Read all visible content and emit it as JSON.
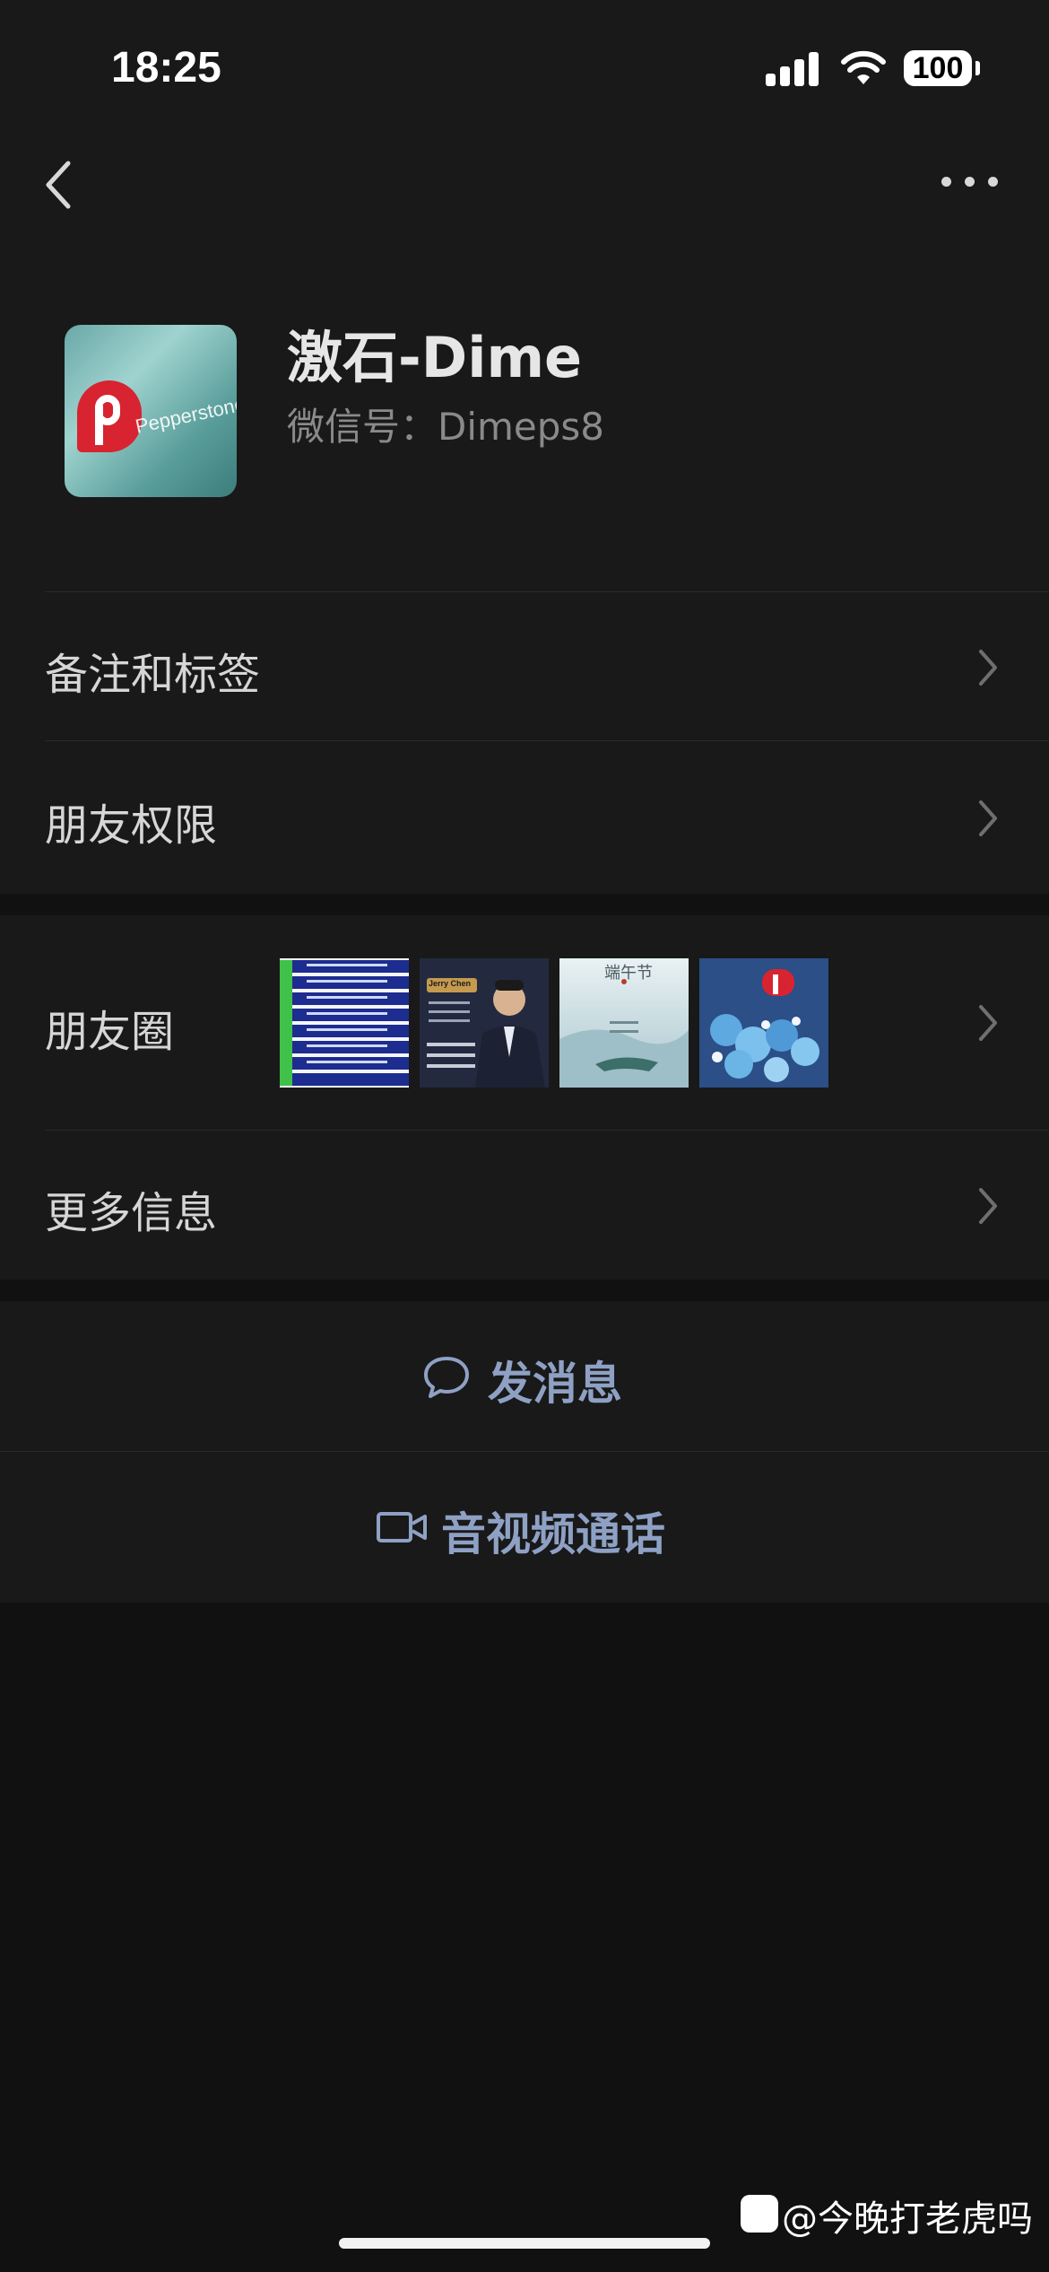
{
  "status_bar": {
    "time": "18:25",
    "battery": "100"
  },
  "profile": {
    "name": "激石-Dime",
    "wechat_id": "微信号：Dimeps8",
    "avatar_text": "Pepperstone"
  },
  "rows": {
    "remarks": "备注和标签",
    "permissions": "朋友权限",
    "moments": "朋友圈",
    "more_info": "更多信息"
  },
  "moments_thumbs": {
    "thumb2_name": "Jerry Chen",
    "thumb3_title": "端午节"
  },
  "actions": {
    "send_message": "发消息",
    "video_call": "音视频通话"
  },
  "watermark": "@今晚打老虎吗",
  "colors": {
    "background": "#111111",
    "row_background": "#191919",
    "action_text": "#8ea1c4"
  }
}
